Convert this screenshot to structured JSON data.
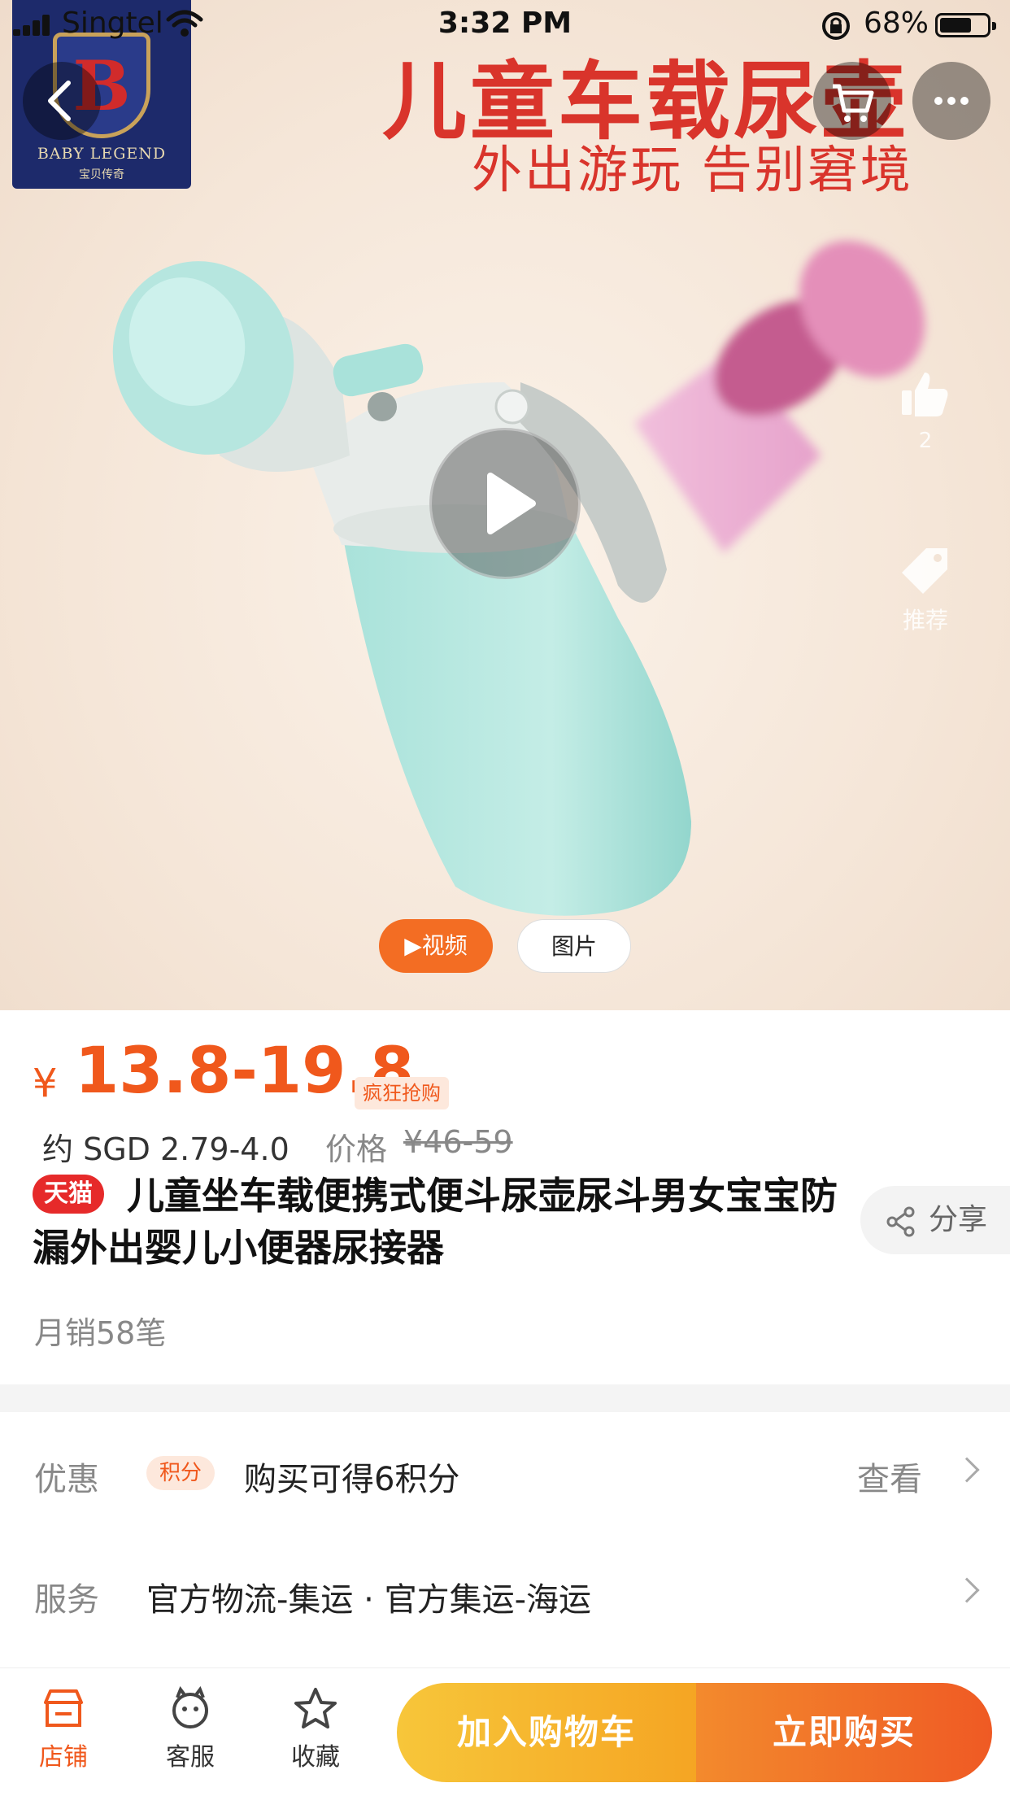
{
  "status_bar": {
    "carrier": "Singtel",
    "time": "3:32 PM",
    "battery": "68%",
    "battery_level": 0.68
  },
  "hero": {
    "brand_logo_letter": "B",
    "brand_logo_name": "BABY LEGEND",
    "brand_logo_sub": "宝贝传奇",
    "headline": "儿童车载尿壶",
    "subline": "外出游玩 告别窘境",
    "like_count": "2",
    "recommend_label": "推荐",
    "toggle_video": "▶视频",
    "toggle_image": "图片"
  },
  "product": {
    "price_symbol": "¥",
    "price": "13.8-19.8",
    "promo_tag": "疯狂抢购",
    "sgd_price": "约 SGD 2.79-4.0",
    "original_label": "价格",
    "original_price": "¥46-59",
    "store_badge": "天猫",
    "title": "儿童坐车载便携式便斗尿壶尿斗男女宝宝防漏外出婴儿小便器尿接器",
    "share_label": "分享",
    "monthly_sales": "月销58笔"
  },
  "rows": {
    "promo_label": "优惠",
    "points_tag": "积分",
    "points_text": "购买可得6积分",
    "view_link": "查看",
    "service_label": "服务",
    "service_text": "官方物流-集运 · 官方集运-海运"
  },
  "bottom_bar": {
    "store": "店铺",
    "customer_service": "客服",
    "favorite": "收藏",
    "add_to_cart": "加入购物车",
    "buy_now": "立即购买"
  },
  "colors": {
    "accent": "#f0581c",
    "tmall_red": "#e62a2a",
    "cart_yellow": "#f7c63a",
    "buy_orange": "#ef5a24"
  },
  "icons": [
    "signal-icon",
    "wifi-icon",
    "rotation-lock-icon",
    "battery-icon",
    "back-icon",
    "cart-icon",
    "more-icon",
    "thumbs-up-icon",
    "tag-icon",
    "play-icon",
    "share-icon",
    "store-icon",
    "customer-service-icon",
    "star-icon",
    "chevron-right-icon"
  ]
}
